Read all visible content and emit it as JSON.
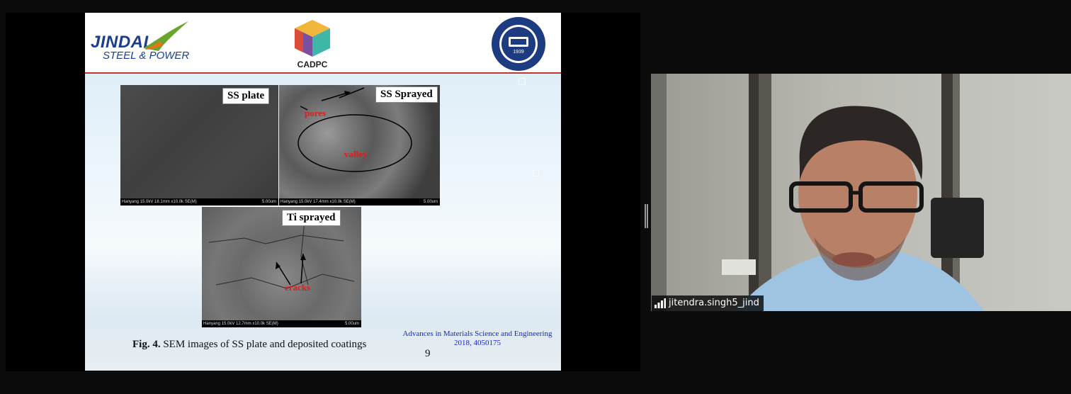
{
  "slide": {
    "logos": {
      "jindal_name": "JINDAL",
      "jindal_sub": "STEEL & POWER",
      "cadpc": "CADPC",
      "university_seal_year": "1939"
    },
    "panels": [
      {
        "label": "SS plate",
        "meta": "Hanyang 15.0kV 18.1mm x10.0k SE(M)",
        "scale": "5.00um"
      },
      {
        "label": "SS Sprayed",
        "meta": "Hanyang 15.0kV 17.4mm x10.0k SE(M)",
        "scale": "5.00um",
        "annotations": [
          "pores",
          "valley"
        ]
      },
      {
        "label": "Ti sprayed",
        "meta": "Hanyang 15.0kV 12.7mm x10.0k SE(M)",
        "scale": "5.00um",
        "annotations": [
          "cracks"
        ]
      }
    ],
    "caption_bold": "Fig. 4.",
    "caption_text": " SEM images of SS plate and deposited coatings",
    "citation_line1": "Advances in Materials Science and Engineering",
    "citation_line2": "2018, 4050175",
    "page_number": "9"
  },
  "participant": {
    "name": "jitendra.singh5_jind",
    "icon": "signal-bars-icon"
  },
  "colors": {
    "background": "#0b0b0b",
    "jindal_blue": "#1b3f8e",
    "header_rule": "#c0392b",
    "annotation_red": "#e21b1b",
    "citation_blue": "#1a27c9"
  }
}
